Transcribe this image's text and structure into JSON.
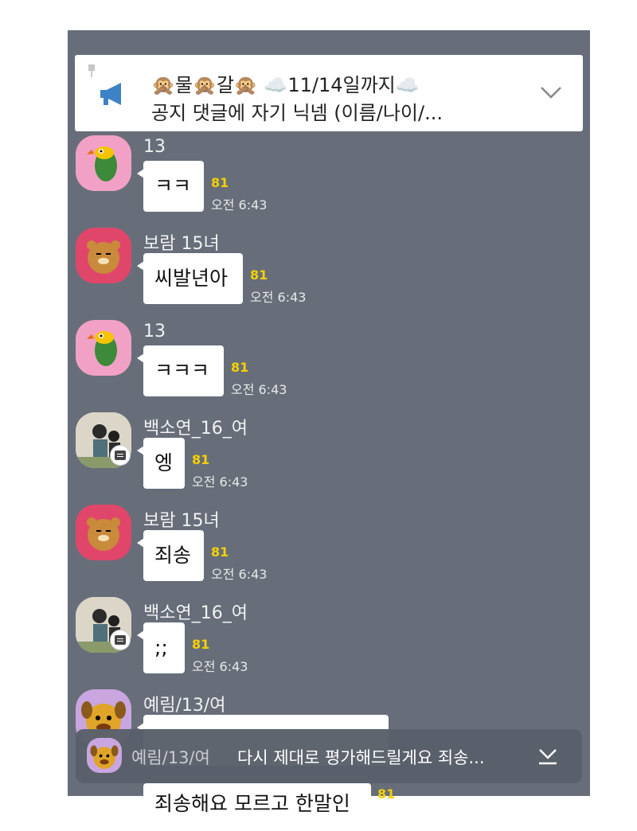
{
  "notice": {
    "line1": "🙊물🙊갈🙊 ☁️11/14일까지☁️",
    "line2": "공지 댓글에 자기 닉넴 (이름/나이/..."
  },
  "messages": [
    {
      "sender": "13",
      "text": "ㅋㅋ",
      "count": "81",
      "time": "오전 6:43"
    },
    {
      "sender": "보람 15녀",
      "text": "씨발년아",
      "count": "81",
      "time": "오전 6:43"
    },
    {
      "sender": "13",
      "text": "ㅋㅋㅋ",
      "count": "81",
      "time": "오전 6:43"
    },
    {
      "sender": "백소연_16_여",
      "text": "엥",
      "count": "81",
      "time": "오전 6:43"
    },
    {
      "sender": "보람 15녀",
      "text": "죄송",
      "count": "81",
      "time": "오전 6:43"
    },
    {
      "sender": "백소연_16_여",
      "text": ";;",
      "count": "81",
      "time": "오전 6:43"
    },
    {
      "sender": "예림/13/여"
    }
  ],
  "bottom_partial": {
    "text": "죄송해요 모르고 한말인",
    "count": "81"
  },
  "preview": {
    "sender": "예림/13/여",
    "text": "다시 제대로 평가해드릴게요 죄송..."
  },
  "colors": {
    "chat_background": "#676e7a",
    "read_count": "#f5d000",
    "megaphone": "#3d82c4"
  },
  "icons": [
    "pin-icon",
    "megaphone-icon",
    "chevron-down-icon",
    "chat-badge-icon",
    "scroll-down-icon"
  ]
}
